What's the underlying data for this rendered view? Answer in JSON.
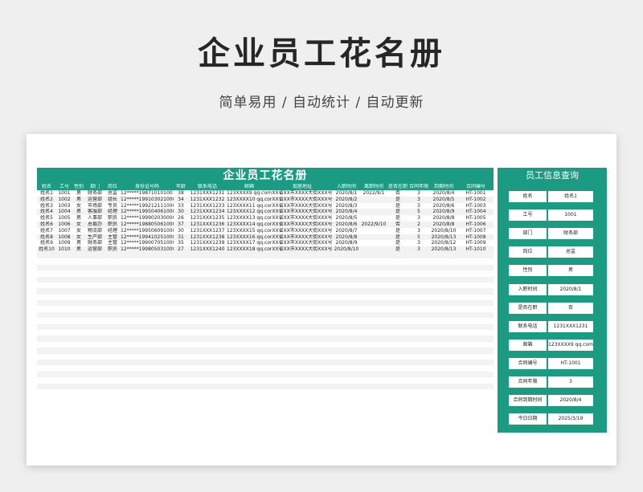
{
  "header": {
    "title": "企业员工花名册",
    "subtitle": "简单易用 / 自动统计 / 自动更新"
  },
  "sheet": {
    "table_title": "企业员工花名册",
    "columns": [
      "姓名",
      "工号",
      "性别",
      "部门",
      "岗位",
      "身份证号码",
      "年龄",
      "联系电话",
      "邮箱",
      "现居地址",
      "入职时间",
      "离职时间",
      "是否在职",
      "合同年限",
      "到期时间",
      "合同编号"
    ],
    "rows": [
      [
        "姓名1",
        "1001",
        "男",
        "财务部",
        "总监",
        "12*****198710101001",
        "38",
        "1231XXX1231",
        "123XXXX9 qq.com",
        "XX省XX市XXXX大街XXX号",
        "2020/8/1",
        "2022/9/1",
        "否",
        "3",
        "2020/8/4",
        "HT-1001"
      ],
      [
        "姓名2",
        "1002",
        "男",
        "运营部",
        "组长",
        "12*****199103021000",
        "34",
        "1231XXX1232",
        "123XXXX10 qq.com",
        "XX省XX市XXXX大街XXX号",
        "2020/8/2",
        "",
        "是",
        "3",
        "2020/8/5",
        "HT-1002"
      ],
      [
        "姓名3",
        "1003",
        "女",
        "市场部",
        "专员",
        "12*****199212111000",
        "33",
        "1231XXX1233",
        "123XXXX11 qq.com",
        "XX省XX市XXXX大街XXX号",
        "2020/8/3",
        "",
        "是",
        "3",
        "2020/8/6",
        "HT-1003"
      ],
      [
        "姓名4",
        "1004",
        "男",
        "客服部",
        "经理",
        "12*****199504061000",
        "30",
        "1231XXX1234",
        "123XXXX12 qq.com",
        "XX省XX市XXXX大街XXX号",
        "2020/8/4",
        "",
        "是",
        "5",
        "2020/8/9",
        "HT-1004"
      ],
      [
        "姓名5",
        "1005",
        "男",
        "人事部",
        "职员",
        "12*****199902030000",
        "26",
        "1231XXX1235",
        "123XXXX13 qq.com",
        "XX省XX市XXXX大街XXX号",
        "2020/8/5",
        "",
        "是",
        "3",
        "2020/8/8",
        "HT-1005"
      ],
      [
        "姓名6",
        "1006",
        "女",
        "总裁办",
        "职员",
        "12*****198805061000",
        "37",
        "1231XXX1236",
        "123XXXX14 qq.com",
        "XX省XX市XXXX大街XXX号",
        "2020/8/6",
        "2022/9/10",
        "否",
        "2",
        "2020/8/8",
        "HT-1006"
      ],
      [
        "姓名7",
        "1007",
        "女",
        "物流部",
        "经理",
        "12*****199506091000",
        "30",
        "1231XXX1237",
        "123XXXX15 qq.com",
        "XX省XX市XXXX大街XXX号",
        "2020/8/7",
        "",
        "是",
        "3",
        "2020/8/10",
        "HT-1007"
      ],
      [
        "姓名8",
        "1008",
        "女",
        "生产部",
        "主管",
        "12*****199410251000",
        "31",
        "1231XXX1238",
        "123XXXX16 qq.com",
        "XX省XX市XXXX大街XXX号",
        "2020/8/8",
        "",
        "是",
        "5",
        "2020/8/13",
        "HT-1008"
      ],
      [
        "姓名9",
        "1009",
        "男",
        "财务部",
        "主管",
        "12*****199007051000",
        "35",
        "1231XXX1239",
        "123XXXX17 qq.com",
        "XX省XX市XXXX大街XXX号",
        "2020/8/9",
        "",
        "是",
        "3",
        "2020/8/12",
        "HT-1009"
      ],
      [
        "姓名10",
        "1010",
        "男",
        "运营部",
        "职员",
        "12*****199805031000",
        "27",
        "1231XXX1240",
        "123XXXX18 qq.com",
        "XX省XX市XXXX大街XXX号",
        "2020/8/10",
        "",
        "是",
        "3",
        "2020/8/13",
        "HT-1010"
      ]
    ]
  },
  "panel": {
    "title": "员工信息查询",
    "fields": [
      {
        "label": "姓名",
        "value": "姓名1"
      },
      {
        "label": "工号",
        "value": "1001"
      },
      {
        "label": "部门",
        "value": "财务部"
      },
      {
        "label": "岗位",
        "value": "总监"
      },
      {
        "label": "性别",
        "value": "男"
      },
      {
        "label": "入职时间",
        "value": "2020/8/1"
      },
      {
        "label": "是否在职",
        "value": "否"
      },
      {
        "label": "联系电话",
        "value": "1231XXX1231"
      },
      {
        "label": "邮箱",
        "value": "123XXXX9 qq.com"
      },
      {
        "label": "合同编号",
        "value": "HT-1001"
      },
      {
        "label": "合同年限",
        "value": "3"
      },
      {
        "label": "合同到期时间",
        "value": "2020/8/4"
      },
      {
        "label": "今日日期",
        "value": "2025/3/19"
      }
    ]
  }
}
